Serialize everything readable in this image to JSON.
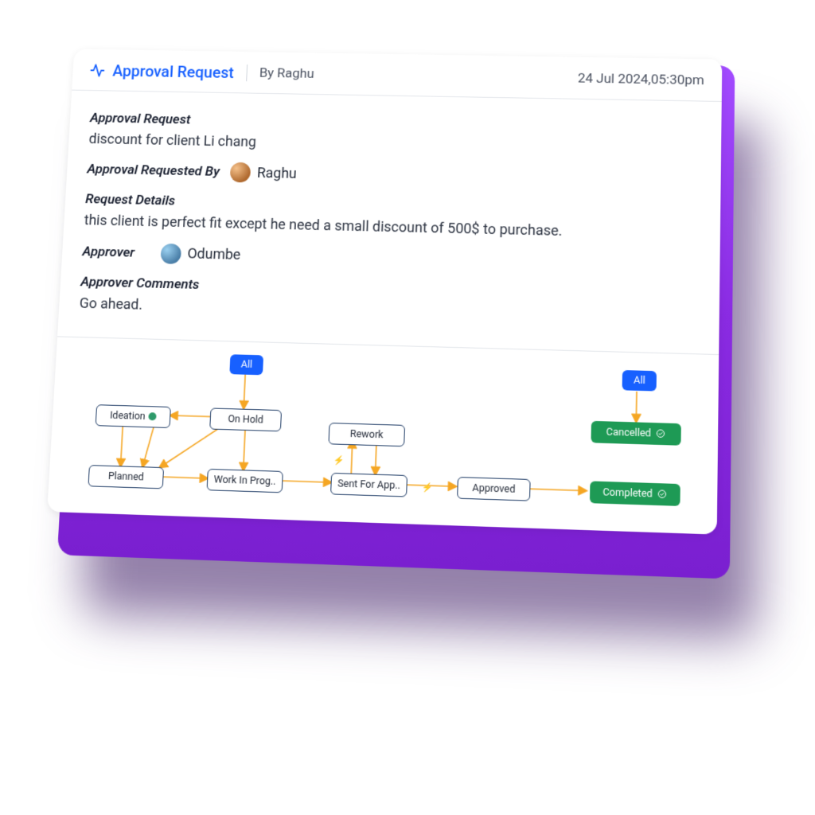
{
  "header": {
    "title": "Approval Request",
    "by_prefix": "By",
    "by_name": "Raghu",
    "datetime": "24 Jul 2024,05:30pm"
  },
  "sections": {
    "approval_request_label": "Approval Request",
    "approval_request_text": "discount for client Li chang",
    "requested_by_label": "Approval Requested By",
    "requested_by_name": "Raghu",
    "details_label": "Request Details",
    "details_text": "this client is perfect fit except he need a small discount of 500$ to purchase.",
    "approver_label": "Approver",
    "approver_name": "Odumbe",
    "approver_comments_label": "Approver Comments",
    "approver_comments_text": "Go ahead."
  },
  "workflow": {
    "all1": "All",
    "all2": "All",
    "ideation": "Ideation",
    "onhold": "On Hold",
    "rework": "Rework",
    "planned": "Planned",
    "wip": "Work In Prog..",
    "sent": "Sent For App..",
    "approved": "Approved",
    "completed": "Completed",
    "cancelled": "Cancelled"
  },
  "colors": {
    "accent_blue": "#1760ff",
    "arrow_orange": "#f5a623",
    "node_border": "#1f3c66",
    "green": "#1e9a55",
    "purple": "#8a2be2"
  }
}
